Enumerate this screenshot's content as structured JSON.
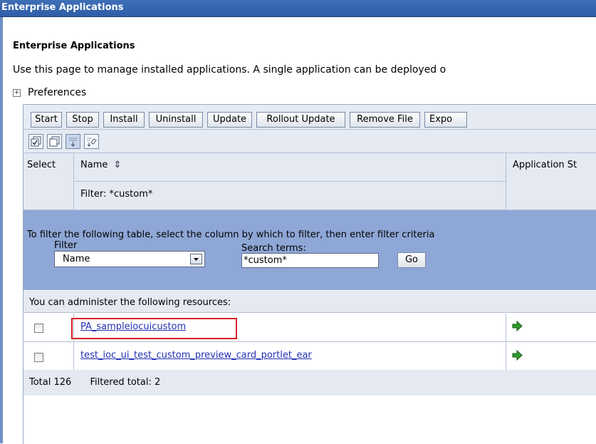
{
  "window": {
    "title": "Enterprise Applications"
  },
  "page": {
    "heading": "Enterprise Applications",
    "description": "Use this page to manage installed applications. A single application can be deployed o",
    "preferences": {
      "expander": "+",
      "label": "Preferences"
    }
  },
  "toolbar": {
    "buttons": [
      "Start",
      "Stop",
      "Install",
      "Uninstall",
      "Update",
      "Rollout Update",
      "Remove File",
      "Expo"
    ]
  },
  "icon_toolbar": {
    "icons": [
      "select-all-icon",
      "deselect-all-icon",
      "show-filter-icon",
      "clear-filter-icon"
    ]
  },
  "table": {
    "headers": {
      "select": "Select",
      "name": "Name",
      "name_sort_glyph": "⇕",
      "status": "Application St"
    },
    "current_filter": "Filter: *custom*",
    "filter_panel": {
      "instructions": "To filter the following table, select the column by which to filter, then enter filter criteria",
      "filter_label": "Filter",
      "filter_value": "Name",
      "search_label": "Search terms:",
      "search_value": "*custom*",
      "go_label": "Go"
    },
    "resources_caption": "You can administer the following resources:",
    "rows": [
      {
        "name": "PA_sampleiocuicustom",
        "checked": false,
        "status_icon": "started-arrow-icon",
        "highlighted": true
      },
      {
        "name": "test_ioc_ui_test_custom_preview_card_portlet_ear",
        "checked": false,
        "status_icon": "started-arrow-icon",
        "highlighted": false
      }
    ],
    "footer": {
      "total": "Total 126",
      "filtered_total": "Filtered total: 2"
    }
  },
  "colors": {
    "title_bar": "#2f5ea8",
    "filter_panel": "#8fa7d6",
    "header_bg": "#e4e9f2",
    "link": "#1f2fb4",
    "highlight": "#d61f26",
    "status_green": "#2e9d2e"
  }
}
